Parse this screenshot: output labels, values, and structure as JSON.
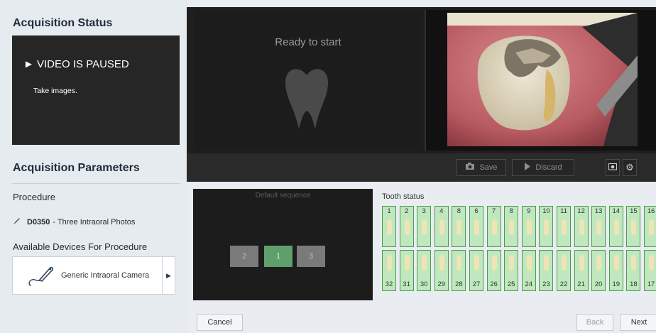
{
  "left_panel": {
    "acquisition_status_title": "Acquisition Status",
    "status_heading": "► VIDEO IS PAUSED",
    "status_sub": "Take images.",
    "acquisition_parameters_title": "Acquisition Parameters",
    "procedure_label": "Procedure",
    "procedure_code": "D0350",
    "procedure_desc": "- Three Intraoral Photos",
    "devices_label": "Available Devices For Procedure",
    "device_name": "Generic Intraoral Camera"
  },
  "viewer": {
    "ready_text": "Ready to start"
  },
  "toolbar": {
    "save_label": "Save",
    "discard_label": "Discard"
  },
  "sequence": {
    "title": "Default sequence",
    "items": [
      "2",
      "1",
      "3"
    ]
  },
  "tooth_status": {
    "label": "Tooth status",
    "upper": [
      "1",
      "2",
      "3",
      "4",
      "8",
      "6",
      "7",
      "8",
      "9",
      "10",
      "11",
      "12",
      "13",
      "14",
      "15",
      "16"
    ],
    "lower": [
      "32",
      "31",
      "30",
      "29",
      "28",
      "27",
      "26",
      "25",
      "24",
      "23",
      "22",
      "21",
      "20",
      "19",
      "18",
      "17"
    ]
  },
  "footer": {
    "cancel_label": "Cancel",
    "back_label": "Back",
    "next_label": "Next"
  },
  "colors": {
    "tooth_fill": "#bfe8bf",
    "tooth_border": "#4d9b4d",
    "active_sequence": "#5f9f6b"
  }
}
